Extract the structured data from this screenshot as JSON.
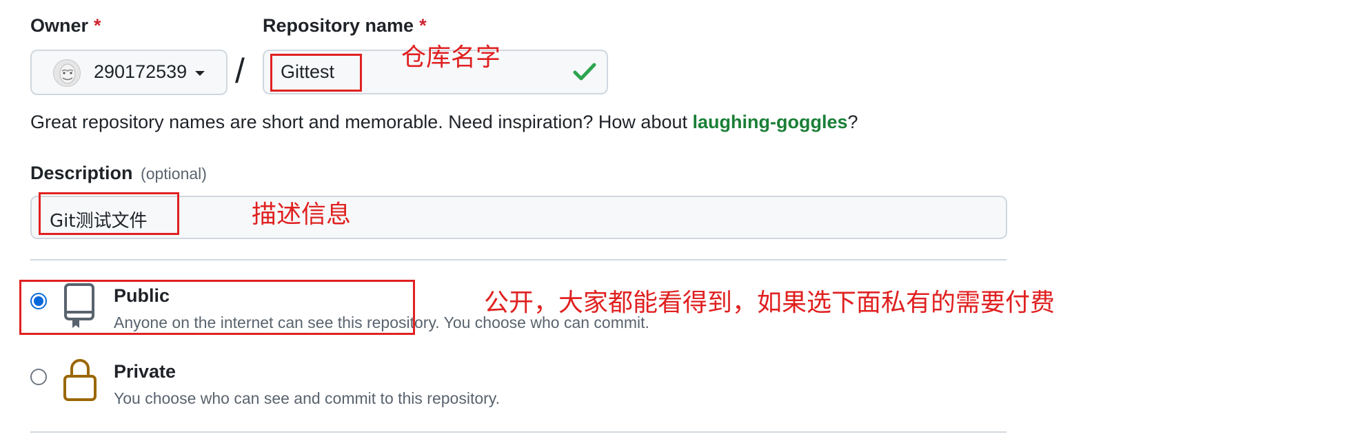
{
  "owner": {
    "label": "Owner",
    "required_mark": "*",
    "value": "290172539",
    "avatar_icon": "avatar-icon",
    "dropdown_icon": "caret-down-icon"
  },
  "separator": "/",
  "repo_name": {
    "label": "Repository name",
    "required_mark": "*",
    "value": "Gittest",
    "valid_icon": "check-icon"
  },
  "hint": {
    "prefix": "Great repository names are short and memorable. Need inspiration? How about ",
    "suggestion": "laughing-goggles",
    "suffix": "?"
  },
  "description": {
    "label": "Description",
    "optional": "(optional)",
    "value": "Git测试文件"
  },
  "visibility": {
    "options": [
      {
        "title": "Public",
        "desc": "Anyone on the internet can see this repository. You choose who can commit.",
        "selected": true,
        "icon": "repo-icon"
      },
      {
        "title": "Private",
        "desc": "You choose who can see and commit to this repository.",
        "selected": false,
        "icon": "lock-icon"
      }
    ]
  },
  "annotations": {
    "repo_name": "仓库名字",
    "description": "描述信息",
    "visibility": "公开，大家都能看得到，如果选下面私有的需要付费"
  },
  "colors": {
    "accent": "#0969da",
    "success": "#1a7f37",
    "check": "#2da44e",
    "annotation": "#e02020",
    "lock": "#9a6700"
  }
}
